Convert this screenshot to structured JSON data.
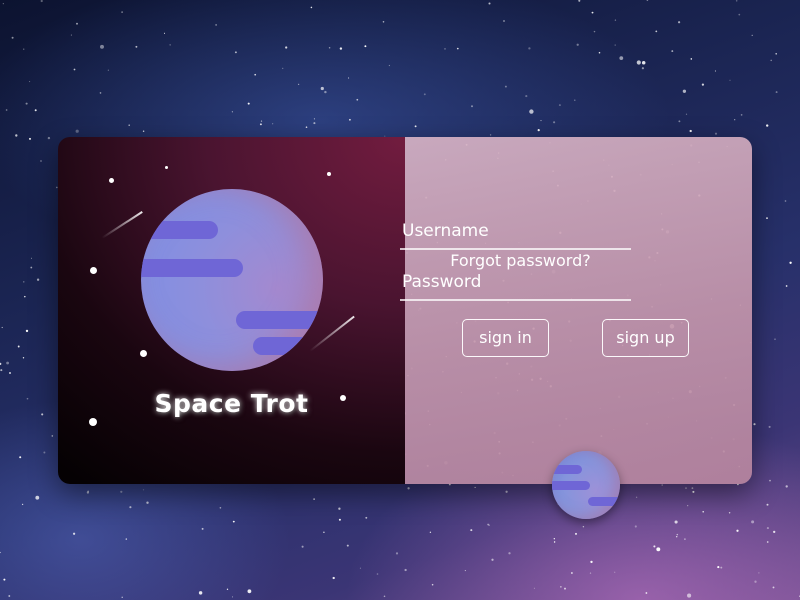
{
  "brand": {
    "title": "Space Trot",
    "icon": "planet-logo"
  },
  "form": {
    "username_label": "Username",
    "password_label": "Password",
    "username_value": "",
    "password_value": ""
  },
  "actions": {
    "sign_in": "sign in",
    "sign_up": "sign up",
    "forgot_password": "Forgot password?"
  },
  "colors": {
    "left_panel_accent": "#721c3f",
    "right_panel": "#c496ac",
    "planet": "#7b8fe6",
    "planet_band": "#6f66d6",
    "text": "#ffffff"
  }
}
